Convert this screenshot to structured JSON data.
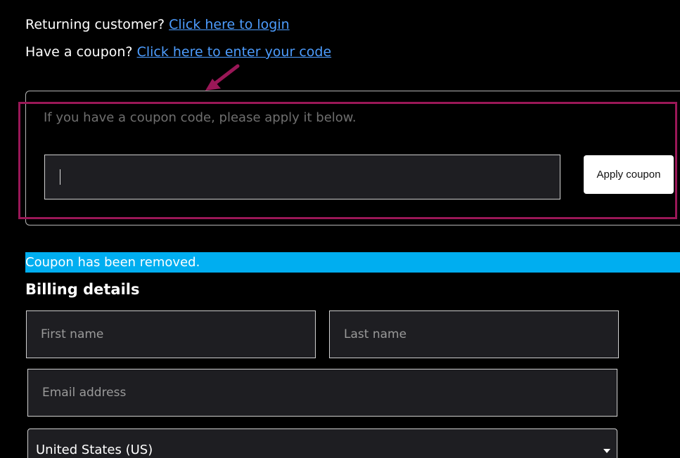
{
  "notices": {
    "login_text": "Returning customer? ",
    "login_link": "Click here to login",
    "coupon_text": "Have a coupon? ",
    "coupon_link": "Click here to enter your code"
  },
  "coupon_form": {
    "hint": "If you have a coupon code, please apply it below.",
    "input_value": "",
    "apply_label": "Apply coupon"
  },
  "message": "Coupon has been removed.",
  "billing": {
    "title": "Billing details",
    "first_name_placeholder": "First name",
    "last_name_placeholder": "Last name",
    "email_placeholder": "Email address",
    "country_value": "United States (US)"
  },
  "colors": {
    "background": "#000000",
    "link": "#4d9dff",
    "message_bar": "#00aef0",
    "annotation": "#9a1757"
  },
  "icons": {
    "annotation_arrow": "arrow-down-left-icon",
    "select_caret": "caret-down-icon"
  }
}
